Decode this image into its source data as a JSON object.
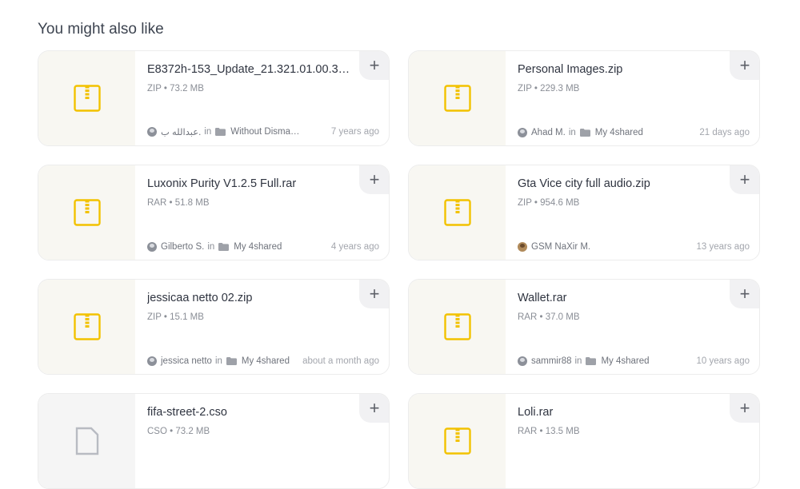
{
  "section": {
    "title": "You might also like"
  },
  "cards": [
    {
      "name": "E8372h-153_Update_21.321.01.00.306_...",
      "meta": "ZIP • 73.2 MB",
      "owner": "عبدالله ب.",
      "in": "in",
      "folder": "Without Disman...",
      "time": "7 years ago",
      "add": "+",
      "icon": "zip-icon",
      "avatar": "default"
    },
    {
      "name": "Personal Images.zip",
      "meta": "ZIP • 229.3 MB",
      "owner": "Ahad M.",
      "in": "in",
      "folder": "My 4shared",
      "time": "21 days ago",
      "add": "+",
      "icon": "zip-icon",
      "avatar": "default"
    },
    {
      "name": "Luxonix Purity V1.2.5 Full.rar",
      "meta": "RAR • 51.8 MB",
      "owner": "Gilberto S.",
      "in": "in",
      "folder": "My 4shared",
      "time": "4 years ago",
      "add": "+",
      "icon": "zip-icon",
      "avatar": "default"
    },
    {
      "name": "Gta Vice city full audio.zip",
      "meta": "ZIP • 954.6 MB",
      "owner": "GSM NaXir M.",
      "in": "",
      "folder": "",
      "time": "13 years ago",
      "add": "+",
      "icon": "zip-icon",
      "avatar": "photo"
    },
    {
      "name": "jessicaa netto 02.zip",
      "meta": "ZIP • 15.1 MB",
      "owner": "jessica netto",
      "in": "in",
      "folder": "My 4shared",
      "time": "about a month ago",
      "add": "+",
      "icon": "zip-icon",
      "avatar": "default"
    },
    {
      "name": "Wallet.rar",
      "meta": "RAR • 37.0 MB",
      "owner": "sammir88",
      "in": "in",
      "folder": "My 4shared",
      "time": "10 years ago",
      "add": "+",
      "icon": "zip-icon",
      "avatar": "default"
    },
    {
      "name": "fifa-street-2.cso",
      "meta": "CSO • 73.2 MB",
      "owner": "",
      "in": "",
      "folder": "",
      "time": "",
      "add": "+",
      "icon": "file-icon",
      "avatar": "none"
    },
    {
      "name": "Loli.rar",
      "meta": "RAR • 13.5 MB",
      "owner": "",
      "in": "",
      "folder": "",
      "time": "",
      "add": "+",
      "icon": "zip-icon",
      "avatar": "none"
    }
  ],
  "colors": {
    "zip_icon": "#f2c200",
    "file_icon": "#b8bbc2",
    "thumb_bg": "#f8f7f2"
  }
}
